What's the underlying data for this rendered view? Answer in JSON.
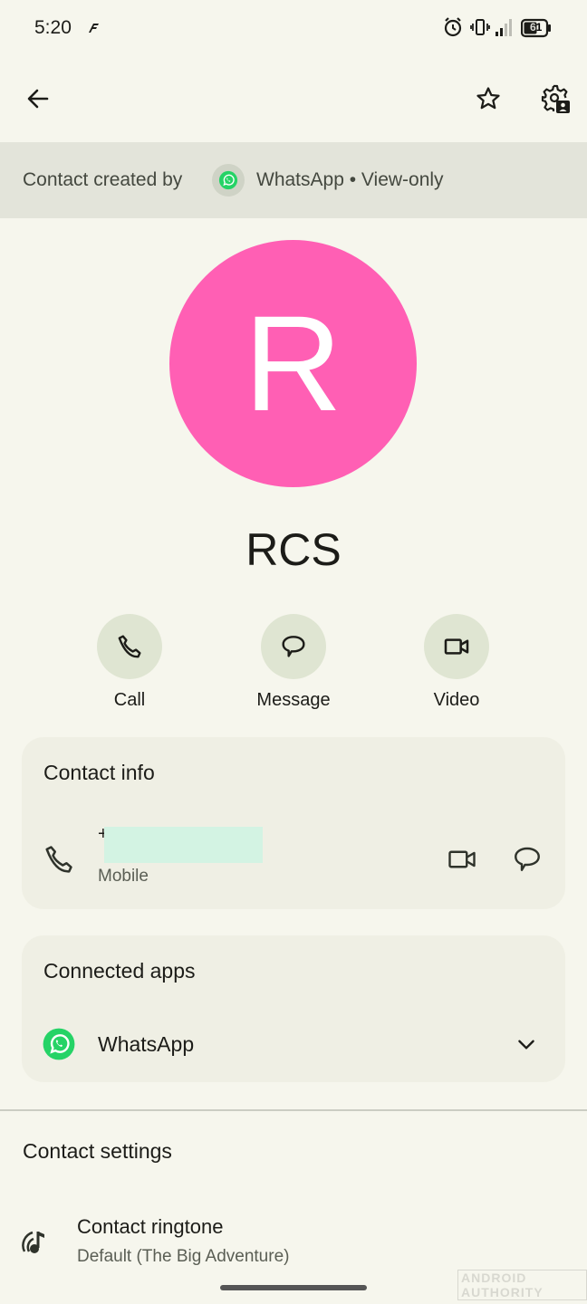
{
  "status_bar": {
    "time": "5:20",
    "battery": "61"
  },
  "banner": {
    "lead_text": "Contact created by",
    "app_text": "WhatsApp • View-only"
  },
  "contact": {
    "initial": "R",
    "name": "RCS",
    "avatar_color": "#ff5fb4"
  },
  "actions": [
    {
      "label": "Call",
      "icon": "phone-icon"
    },
    {
      "label": "Message",
      "icon": "message-icon"
    },
    {
      "label": "Video",
      "icon": "video-icon"
    }
  ],
  "contact_info": {
    "title": "Contact info",
    "phone_prefix": "+",
    "phone_type": "Mobile"
  },
  "connected_apps": {
    "title": "Connected apps",
    "app_name": "WhatsApp"
  },
  "contact_settings": {
    "title": "Contact settings",
    "ringtone_title": "Contact ringtone",
    "ringtone_value": "Default (The Big Adventure)"
  },
  "watermark": "ANDROID AUTHORITY",
  "colors": {
    "background": "#f6f6ed",
    "banner": "#e3e4da",
    "action_circle": "#dfe5d2",
    "card": "#efefe4",
    "whatsapp_green": "#25d366"
  }
}
